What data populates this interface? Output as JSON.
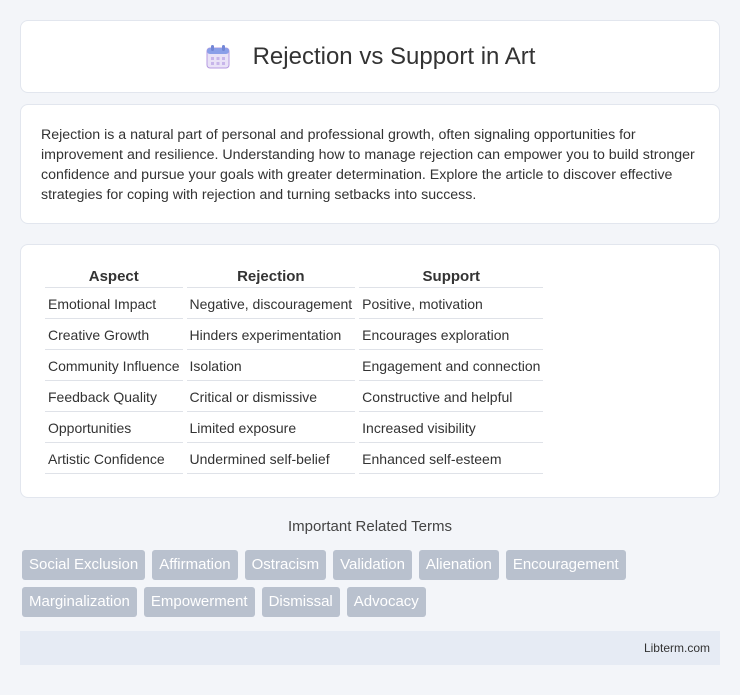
{
  "header": {
    "title": "Rejection vs Support in Art",
    "icon": "calendar-icon"
  },
  "intro": {
    "text": "Rejection is a natural part of personal and professional growth, often signaling opportunities for improvement and resilience. Understanding how to manage rejection can empower you to build stronger confidence and pursue your goals with greater determination. Explore the article to discover effective strategies for coping with rejection and turning setbacks into success."
  },
  "table": {
    "headers": [
      "Aspect",
      "Rejection",
      "Support"
    ],
    "rows": [
      [
        "Emotional Impact",
        "Negative, discouragement",
        "Positive, motivation"
      ],
      [
        "Creative Growth",
        "Hinders experimentation",
        "Encourages exploration"
      ],
      [
        "Community Influence",
        "Isolation",
        "Engagement and connection"
      ],
      [
        "Feedback Quality",
        "Critical or dismissive",
        "Constructive and helpful"
      ],
      [
        "Opportunities",
        "Limited exposure",
        "Increased visibility"
      ],
      [
        "Artistic Confidence",
        "Undermined self-belief",
        "Enhanced self-esteem"
      ]
    ]
  },
  "terms": {
    "title": "Important Related Terms",
    "items": [
      "Social Exclusion",
      "Affirmation",
      "Ostracism",
      "Validation",
      "Alienation",
      "Encouragement",
      "Marginalization",
      "Empowerment",
      "Dismissal",
      "Advocacy"
    ]
  },
  "footer": {
    "text": "Libterm.com"
  }
}
